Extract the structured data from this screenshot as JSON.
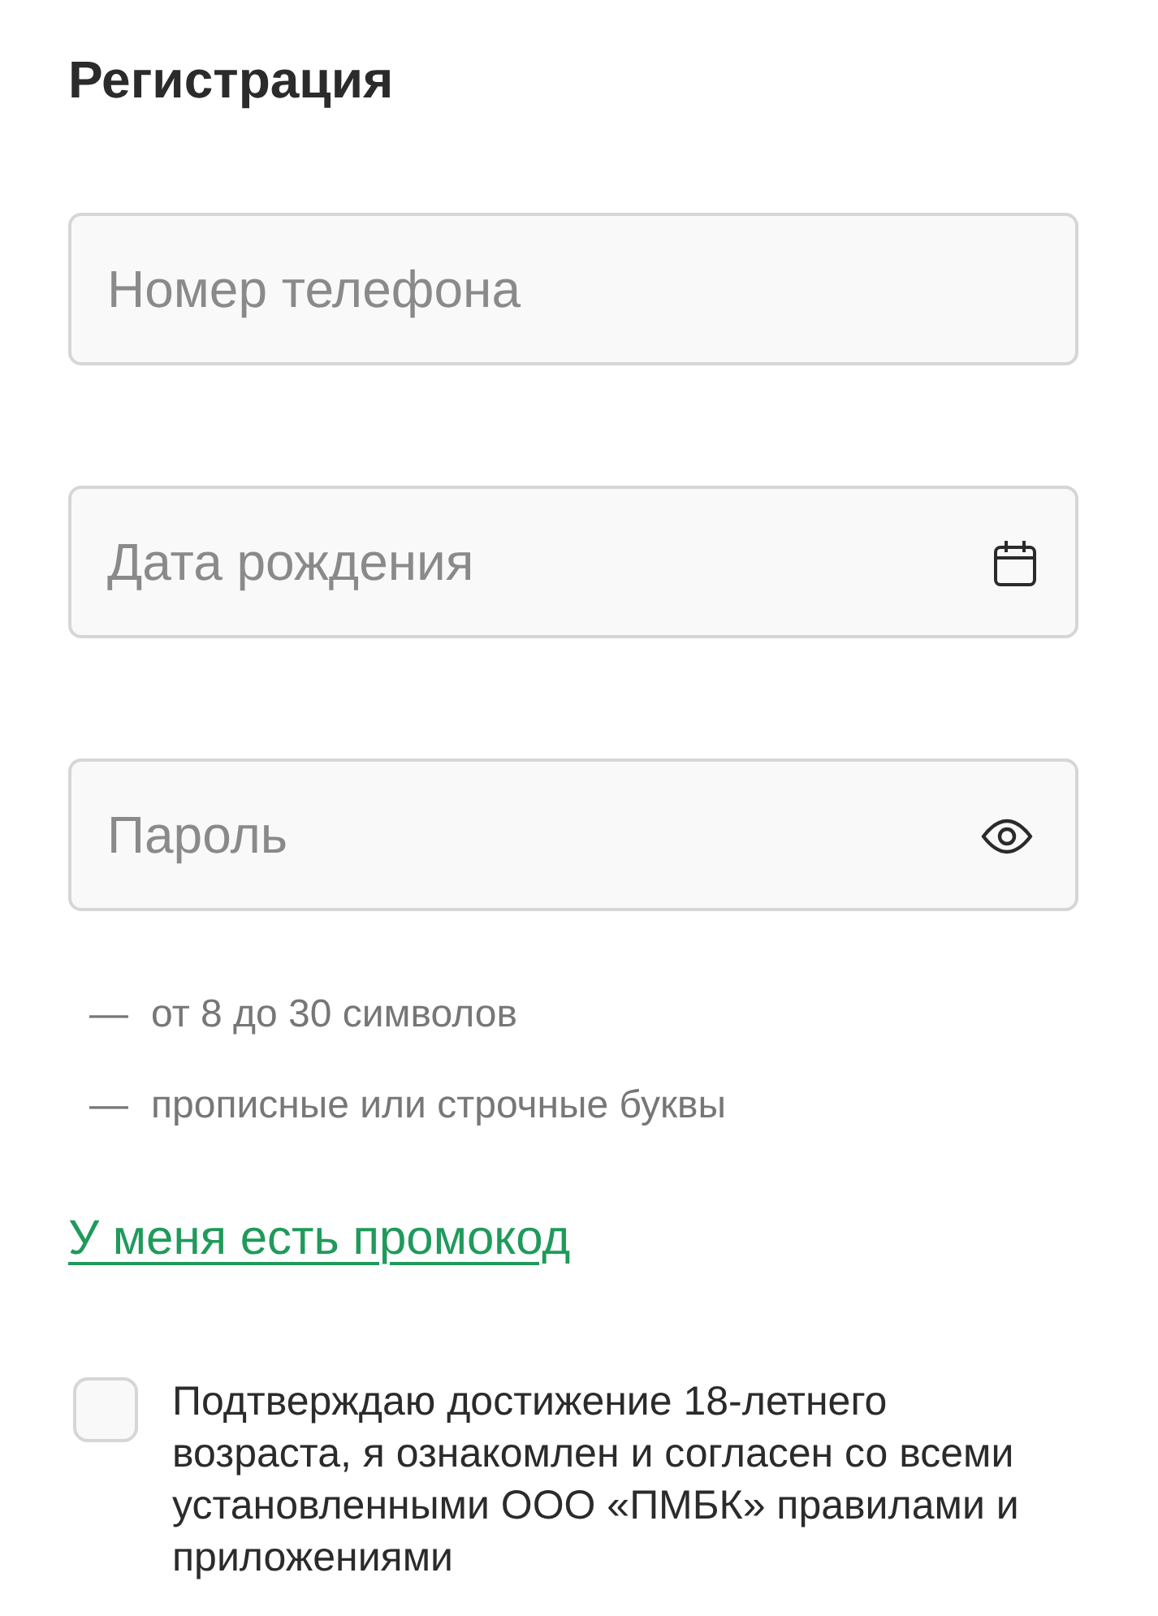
{
  "title": "Регистрация",
  "fields": [
    {
      "kind": "text",
      "placeholder": "Номер телефона"
    },
    {
      "kind": "date",
      "placeholder": "Дата рождения"
    },
    {
      "kind": "password",
      "placeholder": "Пароль"
    }
  ],
  "password_rules": [
    {
      "marker": "—",
      "text": "от 8 до 30 символов"
    },
    {
      "marker": "—",
      "text": "прописные или строчные буквы"
    }
  ],
  "promo_link": "У меня есть промокод",
  "consent": {
    "checked": false,
    "text": "Подтверждаю достижение 18-летнего возраста, я ознакомлен и согласен со всеми установленными ООО «ПМБК» правилами и приложениями"
  }
}
